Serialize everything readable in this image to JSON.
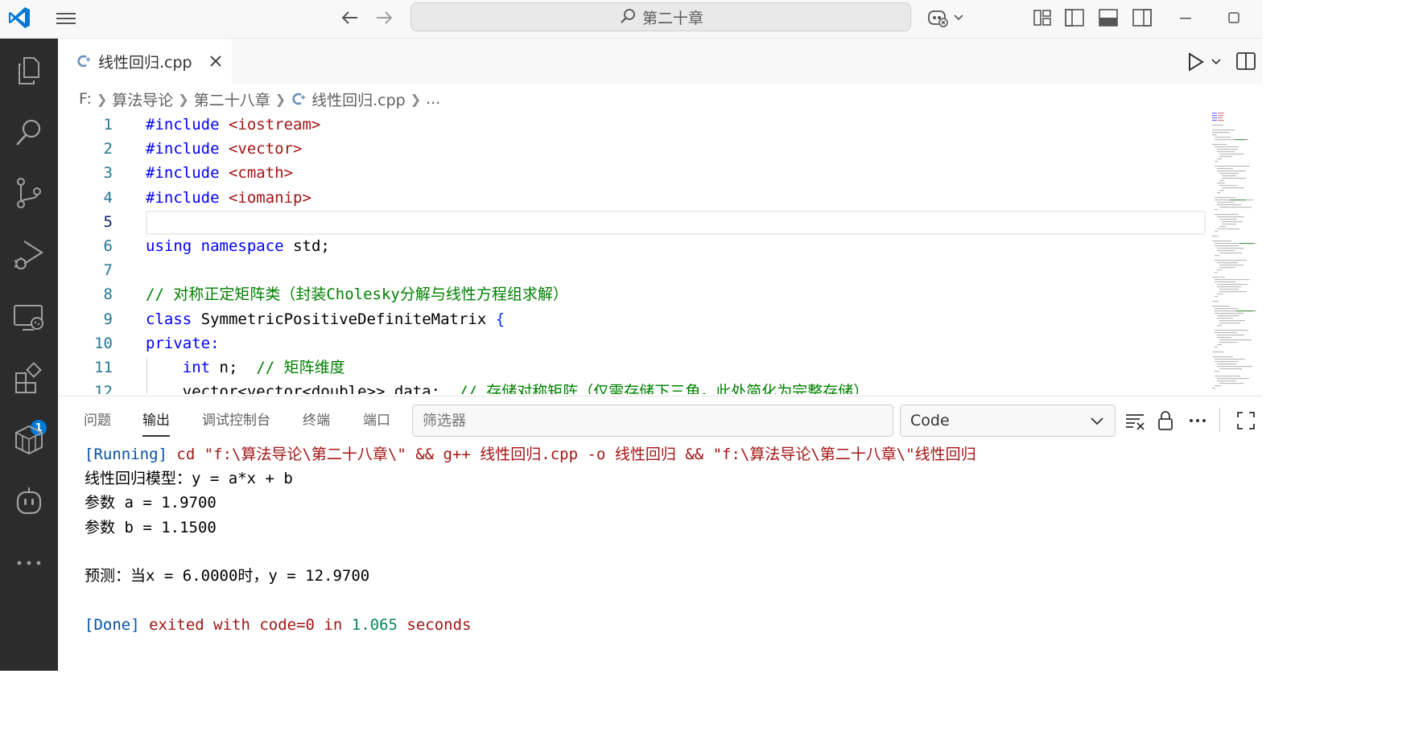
{
  "titlebar": {
    "search_text": "第二十章"
  },
  "activity_bar": {
    "items": [
      "explorer",
      "search",
      "source-control",
      "run-and-debug",
      "remote-explorer",
      "extensions",
      "packages",
      "copilot",
      "more"
    ],
    "extensions_badge": "1"
  },
  "tab": {
    "label": "线性回归.cpp"
  },
  "breadcrumb": {
    "drive": "F:",
    "folder1": "算法导论",
    "folder2": "第二十八章",
    "file": "线性回归.cpp",
    "more": "..."
  },
  "editor": {
    "line_numbers": [
      "1",
      "2",
      "3",
      "4",
      "5",
      "6",
      "7",
      "8",
      "9",
      "10",
      "11",
      "12"
    ],
    "code": {
      "l1_kw": "#include",
      "l1_str": "<iostream>",
      "l2_kw": "#include",
      "l2_str": "<vector>",
      "l3_kw": "#include",
      "l3_str": "<cmath>",
      "l4_kw": "#include",
      "l4_str": "<iomanip>",
      "l6_kw1": "using",
      "l6_kw2": "namespace",
      "l6_rest": "std;",
      "l8_comment": "// 对称正定矩阵类（封装Cholesky分解与线性方程组求解）",
      "l9_kw": "class",
      "l9_name": "SymmetricPositiveDefiniteMatrix",
      "l9_brace": "{",
      "l10_kw": "private:",
      "l11_kw": "int",
      "l11_rest": "n;",
      "l11_comment": "// 矩阵维度",
      "l12_text": "vector<vector<double>> data;",
      "l12_comment": "// 存储对称矩阵（仅需存储下三角，此处简化为完整存储）"
    }
  },
  "panel": {
    "tabs": [
      "问题",
      "输出",
      "调试控制台",
      "终端",
      "端口"
    ],
    "active_tab": "输出",
    "filter_placeholder": "筛选器",
    "channel": "Code",
    "output": {
      "running_tag": "[Running]",
      "running_cmd": "cd \"f:\\算法导论\\第二十八章\\\" && g++ 线性回归.cpp -o 线性回归 && \"f:\\算法导论\\第二十八章\\\"线性回归",
      "line1": "线性回归模型：y = a*x + b",
      "line2": "参数 a = 1.9700",
      "line3": "参数 b = 1.1500",
      "line4": "预测：当x = 6.0000时，y = 12.9700",
      "done_tag": "[Done]",
      "done_text": "exited with code=0 in",
      "done_time": "1.065",
      "done_unit": "seconds"
    }
  },
  "colors": {
    "accent": "#0078d4",
    "activitybar_bg": "#2c2c2c",
    "keyword": "#0000ff",
    "string": "#a31515",
    "comment": "#008000",
    "line_number": "#237893"
  }
}
